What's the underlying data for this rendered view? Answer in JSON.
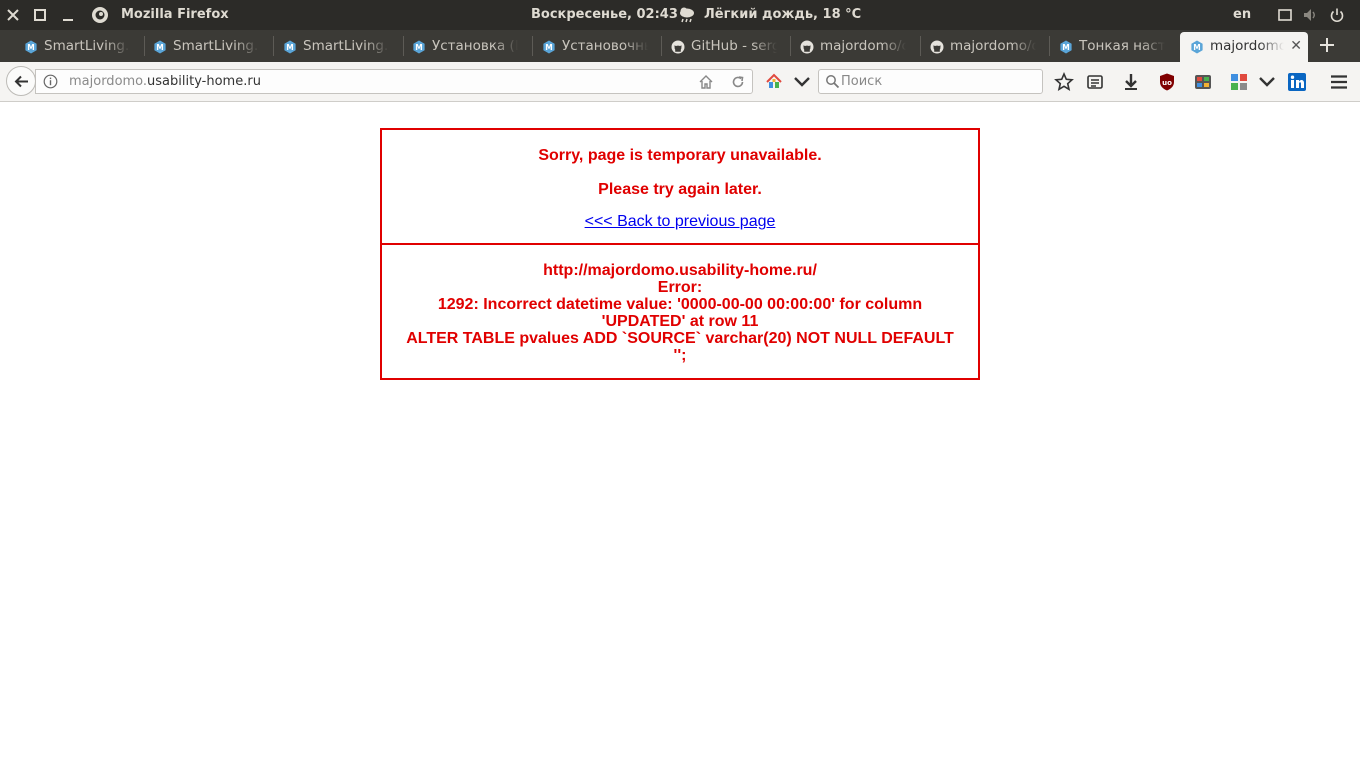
{
  "system": {
    "app_title": "Mozilla Firefox",
    "clock": "Воскресенье, 02:43",
    "weather": "Лёгкий дождь, 18 °C",
    "language": "en"
  },
  "tabs": [
    {
      "label": "SmartLiving.ru",
      "icon": "majordomo-icon"
    },
    {
      "label": "SmartLiving.ru",
      "icon": "majordomo-icon"
    },
    {
      "label": "SmartLiving.ru",
      "icon": "majordomo-icon"
    },
    {
      "label": "Установка (Li",
      "icon": "majordomo-icon"
    },
    {
      "label": "Установочны",
      "icon": "majordomo-icon"
    },
    {
      "label": "GitHub - serg",
      "icon": "github-icon"
    },
    {
      "label": "majordomo/cy",
      "icon": "github-icon"
    },
    {
      "label": "majordomo/di",
      "icon": "github-icon"
    },
    {
      "label": "Тонкая настр",
      "icon": "majordomo-icon"
    },
    {
      "label": "majordomo",
      "icon": "majordomo-icon",
      "active": true
    }
  ],
  "urlbar": {
    "host_prefix": "majordomo.",
    "host": "usability-home.ru"
  },
  "search": {
    "placeholder": "Поиск"
  },
  "page": {
    "sorry": "Sorry, page is temporary unavailable.",
    "try_again": "Please try again later.",
    "back_link": "<<< Back to previous page",
    "error_url": "http://majordomo.usability-home.ru/",
    "error_label": "Error:",
    "error_line1": "1292: Incorrect datetime value: '0000-00-00 00:00:00' for column",
    "error_line2": "'UPDATED' at row 11",
    "error_line3": "ALTER TABLE pvalues ADD `SOURCE` varchar(20) NOT NULL DEFAULT",
    "error_line4": "'';"
  },
  "colors": {
    "error_red": "#e00000",
    "link_blue": "#0000ee",
    "system_bar": "#2c2b28",
    "tab_strip": "#3b3a36"
  }
}
